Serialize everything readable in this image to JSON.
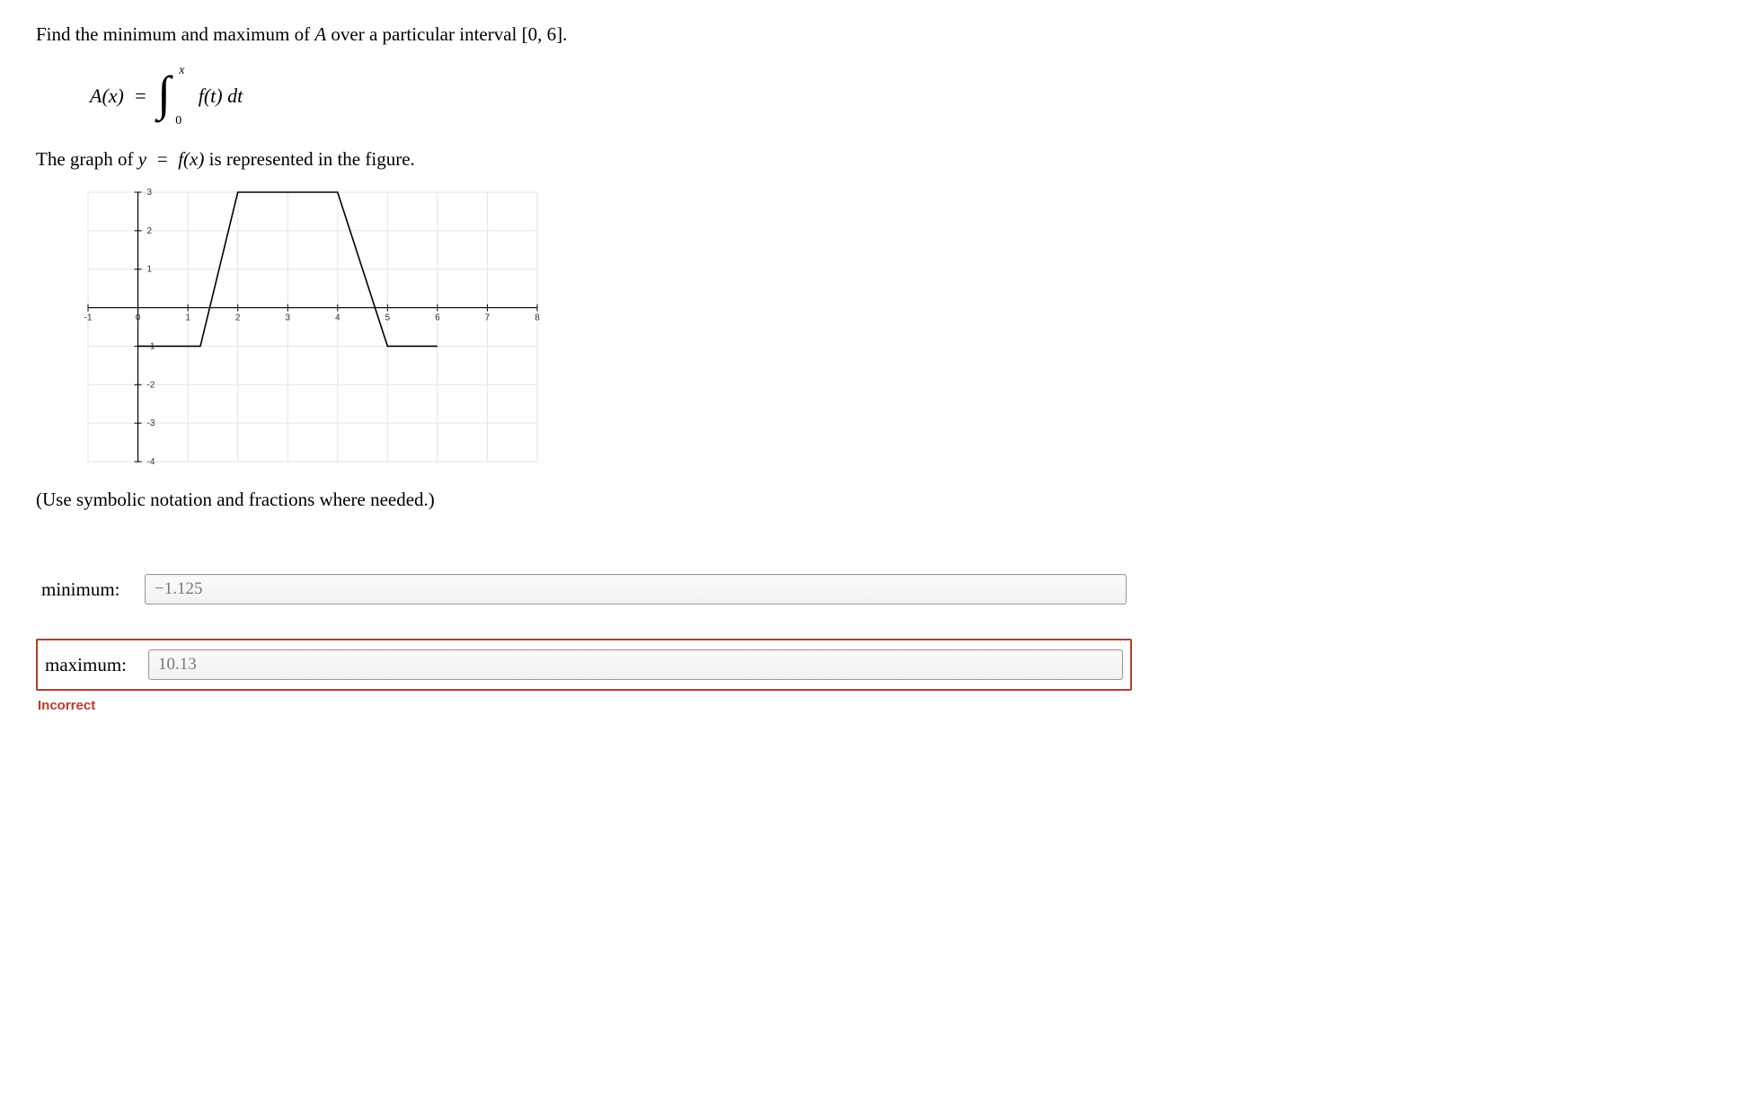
{
  "question": {
    "prompt_prefix": "Find the minimum and maximum of ",
    "prompt_var": "A",
    "prompt_mid": " over a particular interval ",
    "interval": "[0, 6].",
    "formula": {
      "lhs": "A(x) = ",
      "upper": "x",
      "lower": "0",
      "integrand": "f(t) dt"
    },
    "graph_sentence_prefix": "The graph of ",
    "graph_eq": "y = f(x)",
    "graph_sentence_suffix": " is represented in the figure.",
    "hint": "(Use symbolic notation and fractions where needed.)"
  },
  "answers": {
    "minimum_label": "minimum:",
    "maximum_label": "maximum:",
    "minimum_value": "−1.125",
    "maximum_value": "10.13"
  },
  "feedback": {
    "incorrect": "Incorrect"
  },
  "chart_data": {
    "type": "line",
    "title": "",
    "xlabel": "",
    "ylabel": "",
    "xlim": [
      -1,
      8
    ],
    "ylim": [
      -4,
      3
    ],
    "xticks": [
      -1,
      0,
      1,
      2,
      3,
      4,
      5,
      6,
      7,
      8
    ],
    "yticks": [
      -4,
      -3,
      -2,
      -1,
      0,
      1,
      2,
      3
    ],
    "series": [
      {
        "name": "f(x)",
        "points": [
          {
            "x": 0,
            "y": -1
          },
          {
            "x": 1.25,
            "y": -1
          },
          {
            "x": 2,
            "y": 3
          },
          {
            "x": 4,
            "y": 3
          },
          {
            "x": 5,
            "y": -1
          },
          {
            "x": 6,
            "y": -1
          }
        ]
      }
    ]
  }
}
